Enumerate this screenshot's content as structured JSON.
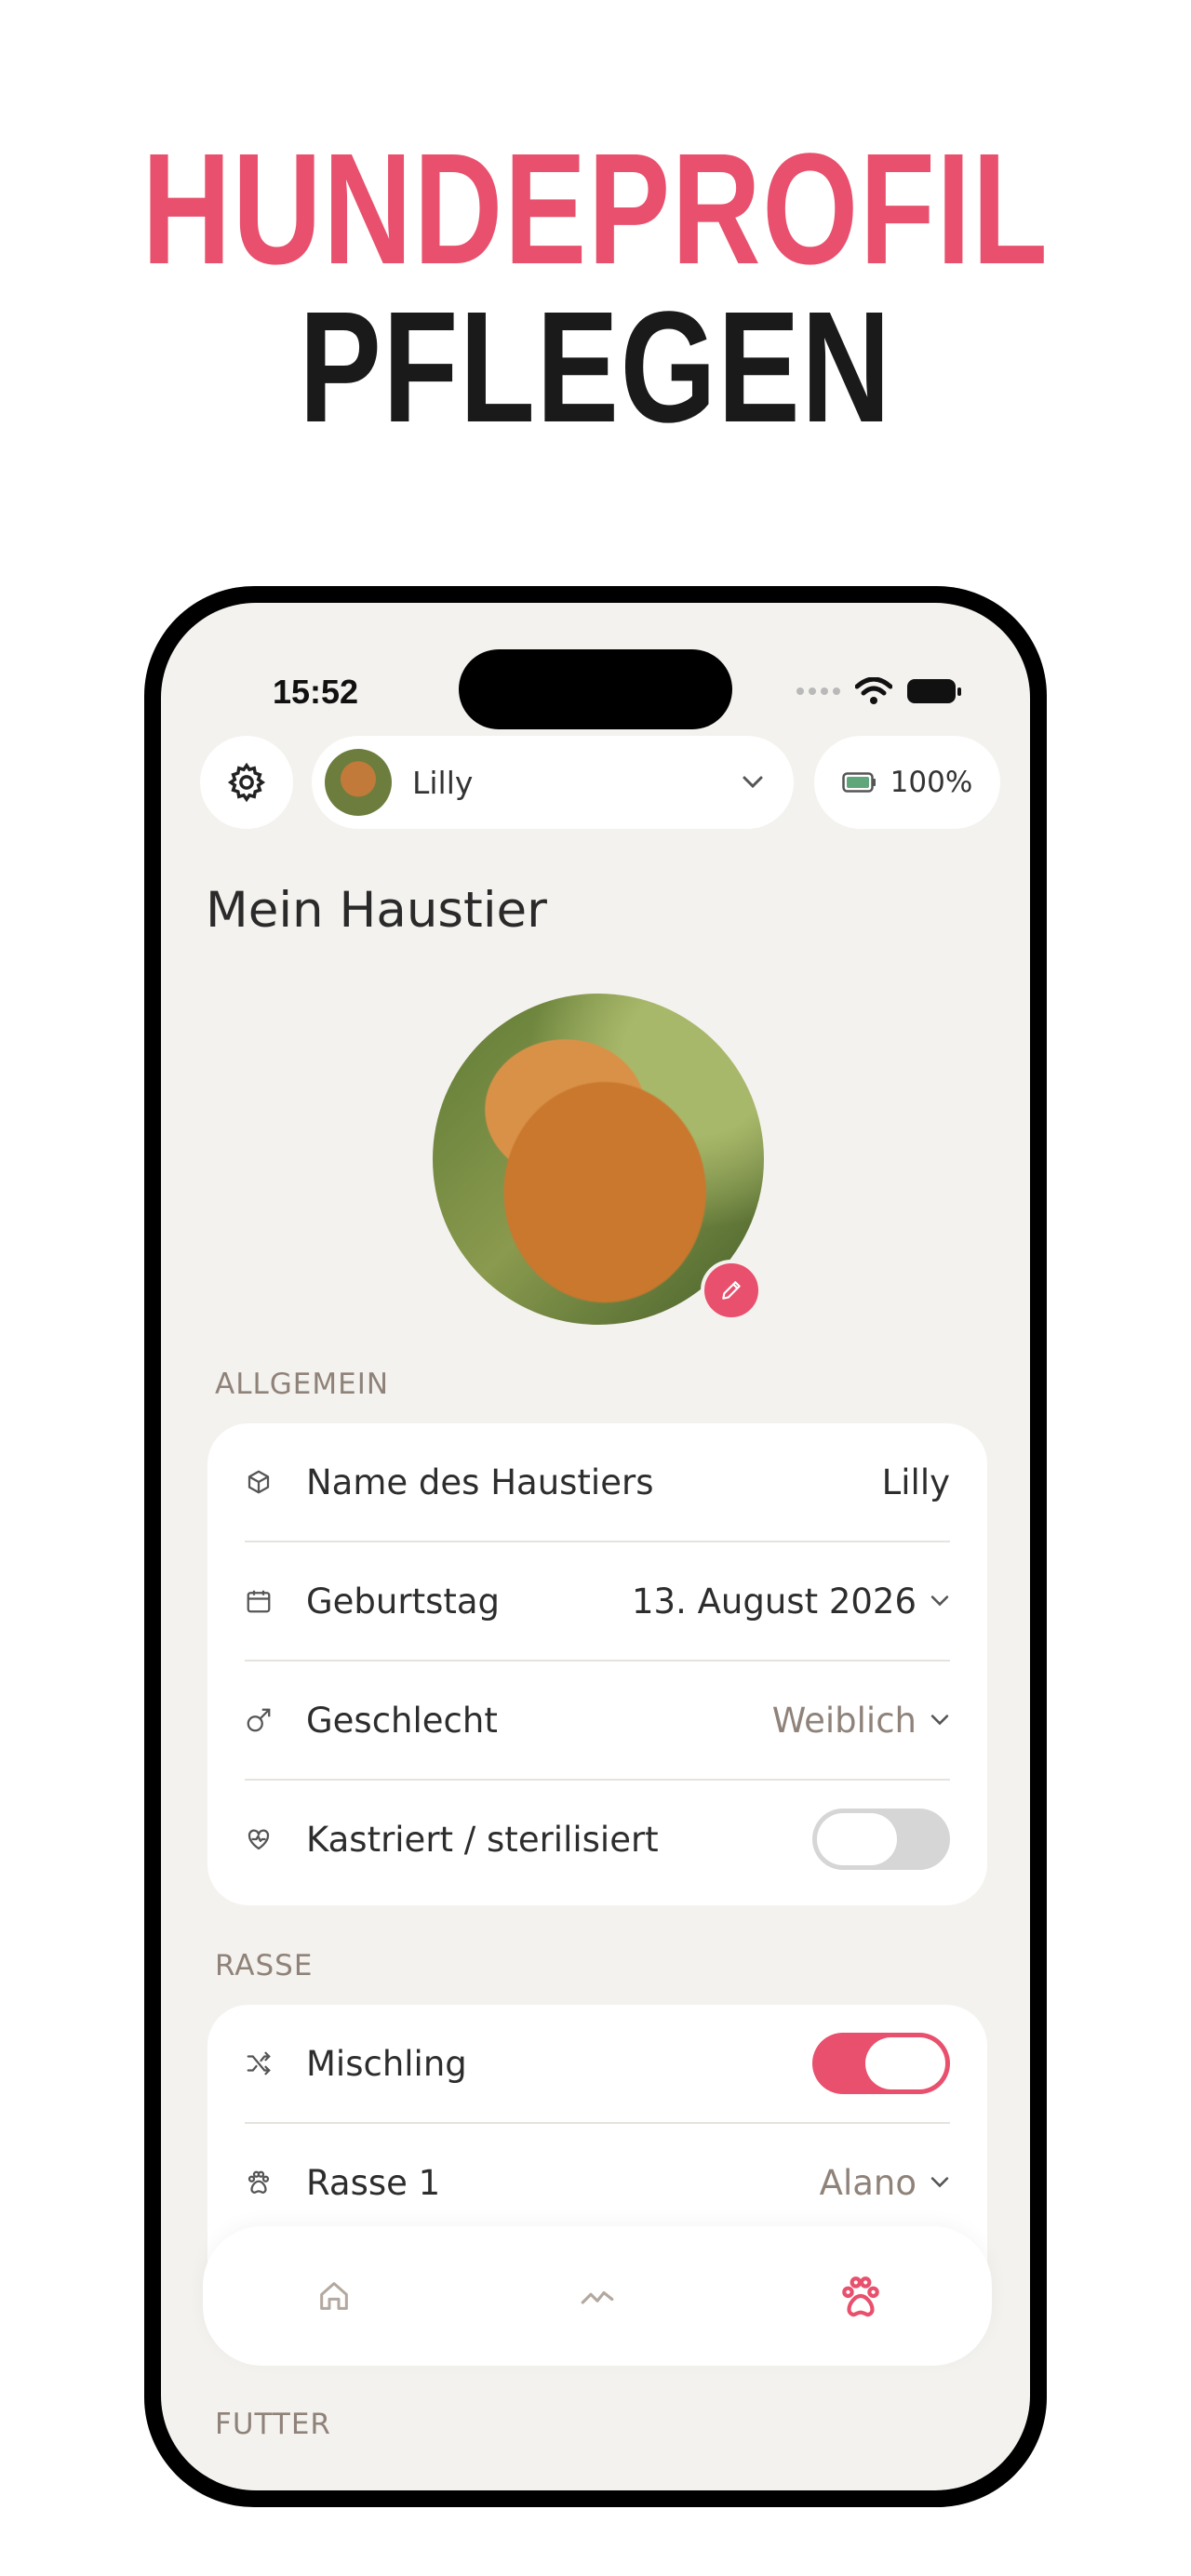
{
  "headline": {
    "line1": "HUNDEPROFIL",
    "line2": "PFLEGEN",
    "line1_color": "#e8506d",
    "line2_color": "#1a1a1a"
  },
  "status_bar": {
    "time": "15:52"
  },
  "top_bar": {
    "pet_name": "Lilly",
    "battery": "100%"
  },
  "page_title": "Mein Haustier",
  "sections": {
    "general": {
      "label": "ALLGEMEIN",
      "rows": [
        {
          "label": "Name des Haustiers",
          "value": "Lilly"
        },
        {
          "label": "Geburtstag",
          "value": "13. August 2026"
        },
        {
          "label": "Geschlecht",
          "value": "Weiblich"
        },
        {
          "label": "Kastriert / sterilisiert",
          "toggle": false
        }
      ]
    },
    "breed": {
      "label": "RASSE",
      "rows": [
        {
          "label": "Mischling",
          "toggle": true
        },
        {
          "label": "Rasse 1",
          "value": "Alano"
        }
      ]
    },
    "food": {
      "label": "FUTTER"
    }
  },
  "tabs": [
    {
      "icon": "home-icon"
    },
    {
      "icon": "activity-chart-icon"
    },
    {
      "icon": "paw-icon",
      "active": true
    }
  ],
  "colors": {
    "accent": "#e8506d",
    "background": "#f4f2ee",
    "muted": "#8f8279"
  }
}
